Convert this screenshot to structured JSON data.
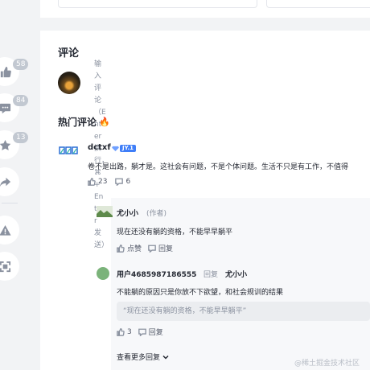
{
  "rail": {
    "like_count": "58",
    "comment_count": "84",
    "collect_count": "13"
  },
  "comments": {
    "title": "评论",
    "input_placeholder": "输入评论（Enter换行，⌘ + Enter发送）",
    "hot_title": "热门评论",
    "main": {
      "author": "dctxf",
      "level": "JY.1",
      "text": "卷不是出路，躺才是。这社会有问题，不是个体问题。生活不只是有工作，不值得",
      "like_count": "23",
      "reply_count": "6"
    },
    "replies": [
      {
        "author": "尤小小",
        "author_tag": "(作者)",
        "text": "现在还没有躺的资格，不能早早躺平",
        "like_label": "点赞",
        "reply_label": "回复"
      },
      {
        "author": "用户4685987186555",
        "reply_label_inline": "回复",
        "reply_to": "尤小小",
        "text": "不能躺的原因只是你放不下欲望，和社会规训的结果",
        "quote": "“现在还没有躺的资格，不能早早躺平”",
        "like_count": "3",
        "reply_label": "回复"
      }
    ],
    "more_label": "查看更多回复"
  },
  "watermark": "@稀土掘金技术社区",
  "colors": {
    "accent": "#3f7ef8",
    "fire": "#f53f3f",
    "muted": "#8a919f"
  }
}
